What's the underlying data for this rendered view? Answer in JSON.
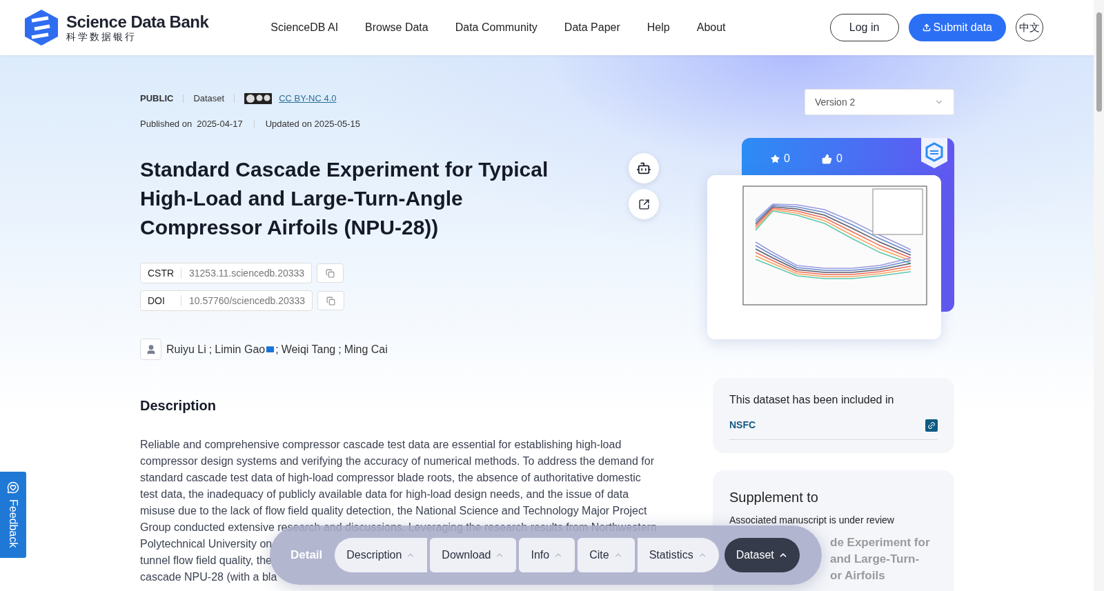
{
  "header": {
    "logo_name": "Science Data Bank",
    "logo_subtitle": "科学数据银行",
    "nav": [
      "ScienceDB AI",
      "Browse Data",
      "Data Community",
      "Data Paper",
      "Help",
      "About"
    ],
    "login": "Log in",
    "submit": "Submit data",
    "language": "中文"
  },
  "meta": {
    "access": "PUBLIC",
    "type": "Dataset",
    "license": "CC BY-NC 4.0",
    "published_label": "Published on",
    "published": "2025-04-17",
    "updated": "Updated on 2025-05-15"
  },
  "title": "Standard Cascade Experiment for Typical High-Load and Large-Turn-Angle Compressor Airfoils (NPU-28))",
  "identifiers": [
    {
      "label": "CSTR",
      "value": "31253.11.sciencedb.20333"
    },
    {
      "label": "DOI",
      "value": "10.57760/sciencedb.20333"
    }
  ],
  "authors": [
    {
      "name": "Ruiyu Li",
      "email": false,
      "separator": ";"
    },
    {
      "name": "Limin Gao",
      "email": true,
      "separator": ";"
    },
    {
      "name": "Weiqi Tang",
      "email": false,
      "separator": ";"
    },
    {
      "name": "Ming Cai",
      "email": false
    }
  ],
  "description": {
    "heading": "Description",
    "lines": [
      "Reliable and comprehensive compressor cascade test data are essential for establishing high-load",
      "compressor design systems and verifying the accuracy of numerical methods. To address the demand for",
      "standard cascade test data of high-load compressor blade roots, the absence of authoritative domestic",
      "test data, the inadequacy of publicly available data for high-load design needs, and the issue of data",
      "misuse due to the lack of flow field quality detection, the National Science and Technology Major Project",
      "Group conducted extensive research and discussions. Leveraging the research results from Northwestern"
    ],
    "covered_fragments": [
      "Polytechnical University on",
      "tunnel flow field quality, the",
      "cascade NPU-28 (with a bla"
    ]
  },
  "version": "Version 2",
  "stats": {
    "favorites": "0",
    "likes": "0"
  },
  "included": {
    "heading": "This dataset has been included in",
    "items": [
      {
        "name": "NSFC"
      }
    ]
  },
  "supplement": {
    "heading": "Supplement to",
    "status": "Associated manuscript is under review",
    "title_fragments": [
      "de Experiment for",
      "and Large-Turn-",
      "or Airfoils"
    ]
  },
  "section_nav": {
    "label": "Detail",
    "tabs": [
      {
        "label": "Description",
        "selected": false
      },
      {
        "label": "Download",
        "selected": false
      },
      {
        "label": "Info",
        "selected": false
      },
      {
        "label": "Cite",
        "selected": false
      },
      {
        "label": "Statistics",
        "selected": false
      },
      {
        "label": "Dataset",
        "selected": true
      }
    ]
  },
  "feedback": "Feedback"
}
